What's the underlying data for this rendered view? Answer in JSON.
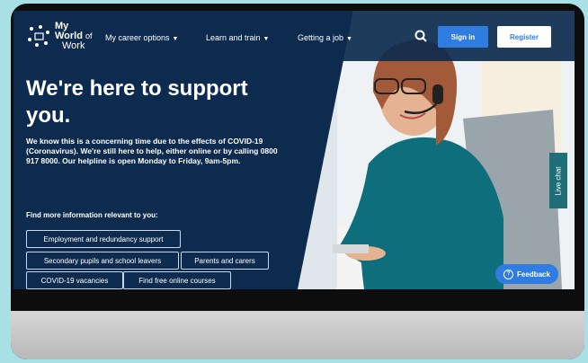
{
  "logo": {
    "line1": "My",
    "line2": "World",
    "line3": "of",
    "line4": "Work"
  },
  "nav": {
    "items": [
      {
        "label": "My career options"
      },
      {
        "label": "Learn and train"
      },
      {
        "label": "Getting a job"
      }
    ],
    "signin_label": "Sign in",
    "register_label": "Register"
  },
  "hero": {
    "title_line1": "We're here to support",
    "title_line2": "you.",
    "body": "We know this is a concerning time due to the effects of COVID-19 (Coronavirus). We're still here to help, either online or by calling 0800 917 8000. Our helpline is open Monday to Friday, 9am-5pm.",
    "find_label": "Find more information relevant to you:"
  },
  "chips": [
    "Employment and redundancy support",
    "Secondary pupils and school leavers",
    "Parents and carers",
    "COVID-19 vacancies",
    "Find free online courses"
  ],
  "live_chat_label": "Live chat",
  "feedback_label": "Feedback",
  "colors": {
    "navy": "#0d2b4e",
    "accent_blue": "#2f7de1",
    "teal": "#1f6f78",
    "background": "#a8e0e6"
  }
}
